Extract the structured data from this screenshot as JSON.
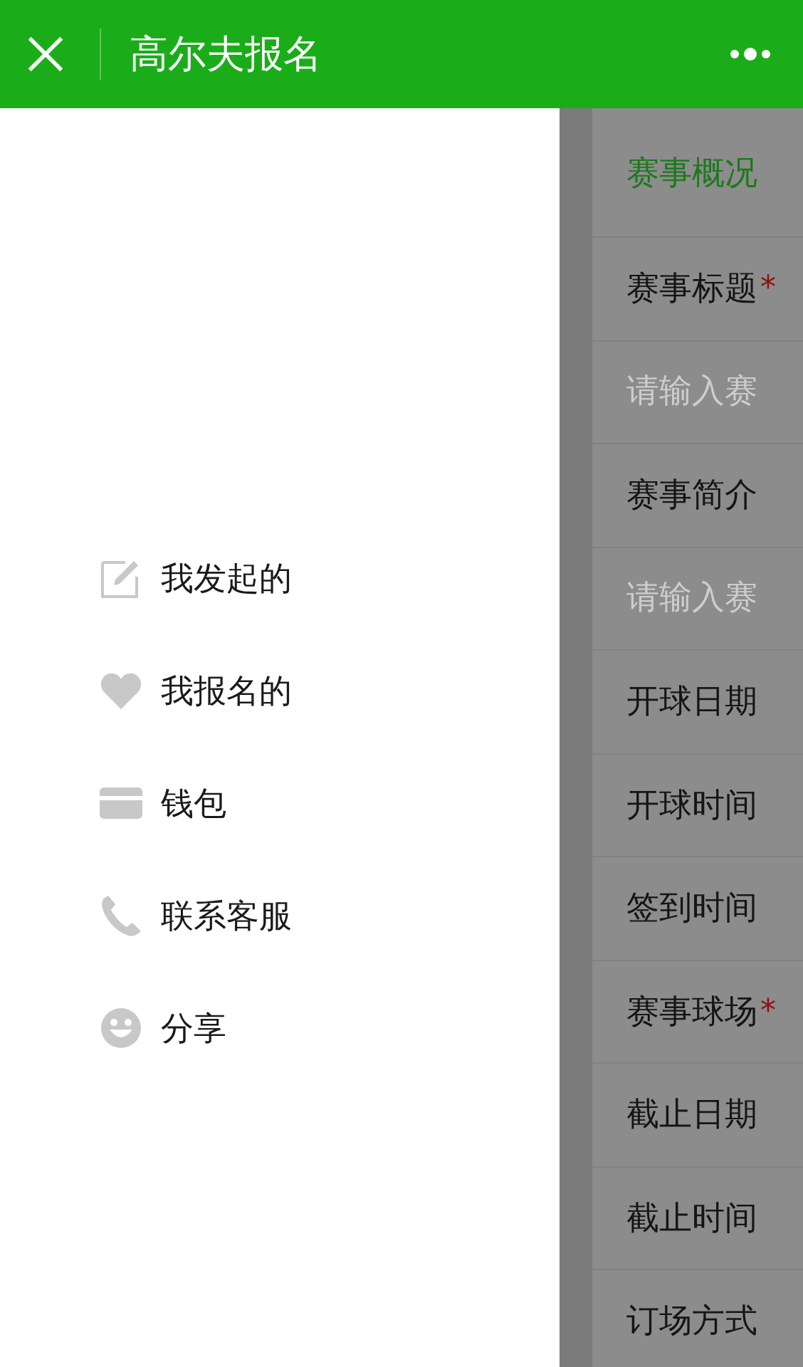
{
  "header": {
    "title": "高尔夫报名"
  },
  "menu": [
    {
      "kind": "edit",
      "label": "我发起的"
    },
    {
      "kind": "heart",
      "label": "我报名的"
    },
    {
      "kind": "card",
      "label": "钱包"
    },
    {
      "kind": "phone",
      "label": "联系客服"
    },
    {
      "kind": "smile",
      "label": "分享"
    }
  ],
  "form": [
    {
      "kind": "section",
      "text": "赛事概况"
    },
    {
      "kind": "label",
      "text": "赛事标题",
      "required_mark": "*"
    },
    {
      "kind": "input",
      "placeholder": "请输入赛"
    },
    {
      "kind": "label",
      "text": "赛事简介"
    },
    {
      "kind": "input",
      "placeholder": "请输入赛"
    },
    {
      "kind": "label",
      "text": "开球日期"
    },
    {
      "kind": "label",
      "text": "开球时间"
    },
    {
      "kind": "label",
      "text": "签到时间"
    },
    {
      "kind": "label",
      "text": "赛事球场",
      "required_mark": "*"
    },
    {
      "kind": "label",
      "text": "截止日期"
    },
    {
      "kind": "label",
      "text": "截止时间"
    },
    {
      "kind": "label",
      "text": "订场方式"
    }
  ]
}
